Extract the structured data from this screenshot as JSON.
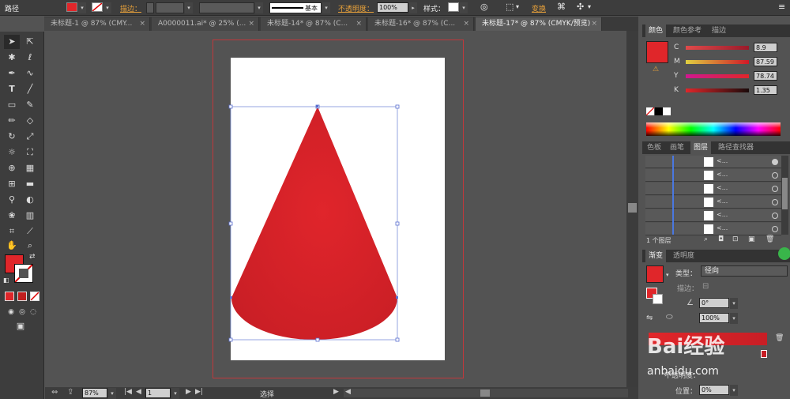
{
  "control_bar": {
    "object_type": "路径",
    "stroke_label": "描边：",
    "brush_label": "基本",
    "opacity_label": "不透明度：",
    "opacity_value": "100%",
    "style_label": "样式：",
    "transform_label": "变换",
    "fill_color": "#e0262a"
  },
  "tabs": [
    {
      "label": "未标题-1 @ 87% (CMY...",
      "close": "×"
    },
    {
      "label": "A0000011.ai* @ 25% (...",
      "close": "×"
    },
    {
      "label": "未标题-14* @ 87% (C...",
      "close": "×"
    },
    {
      "label": "未标题-16* @ 87% (C...",
      "close": "×"
    },
    {
      "label": "未标题-17* @ 87% (CMYK/预览)",
      "close": "×",
      "active": true
    }
  ],
  "status_bar": {
    "zoom": "87%",
    "page": "1",
    "mode": "选择"
  },
  "color_panel": {
    "tabs": [
      "颜色",
      "颜色参考",
      "描边"
    ],
    "sliders": [
      {
        "key": "C",
        "value": "8.9"
      },
      {
        "key": "M",
        "value": "87.59"
      },
      {
        "key": "Y",
        "value": "78.74"
      },
      {
        "key": "K",
        "value": "1.35"
      }
    ]
  },
  "layers_panel": {
    "tabs": [
      "色板",
      "画笔",
      "图层",
      "路径查找器"
    ],
    "rows": [
      "<...",
      "<...",
      "<...",
      "<...",
      "<...",
      "<..."
    ],
    "count_label": "1 个图层"
  },
  "gradient_panel": {
    "tabs": [
      "渐变",
      "透明度"
    ],
    "type_label": "类型：",
    "type_value": "径向",
    "stroke_label": "描边：",
    "angle_value": "0°",
    "aspect_value": "100%",
    "opacity_label": "不透明度：",
    "position_label": "位置：",
    "position_value": "0%"
  },
  "watermark": {
    "text": "Bai经验",
    "url": "anbaidu.com"
  },
  "colors": {
    "cone_red": "#d8242a",
    "accent": "#e0262a"
  }
}
